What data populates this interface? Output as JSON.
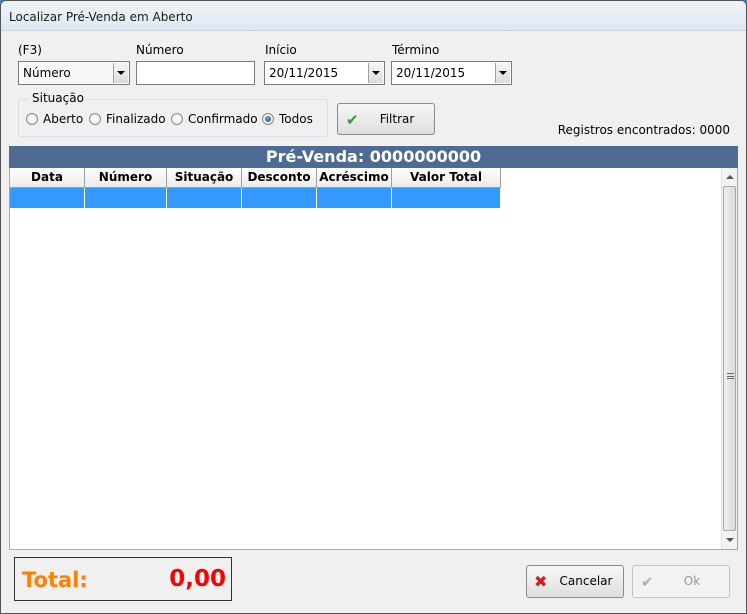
{
  "window": {
    "title": "Localizar Pré-Venda em Aberto"
  },
  "filters": {
    "search_key_label": "(F3)",
    "search_key_value": "Número",
    "numero_label": "Número",
    "numero_value": "",
    "inicio_label": "Início",
    "inicio_value": "20/11/2015",
    "termino_label": "Término",
    "termino_value": "20/11/2015"
  },
  "situacao": {
    "label": "Situação",
    "options": [
      {
        "label": "Aberto",
        "selected": false
      },
      {
        "label": "Finalizado",
        "selected": false
      },
      {
        "label": "Confirmado",
        "selected": false
      },
      {
        "label": "Todos",
        "selected": true
      }
    ]
  },
  "filter_button": {
    "label": "Filtrar",
    "icon": "check-icon"
  },
  "registros_text": "Registros encontrados: 0000",
  "pre_venda_header": "Pré-Venda: 0000000000",
  "grid": {
    "columns": [
      "Data",
      "Número",
      "Situação",
      "Desconto",
      "Acréscimo",
      "Valor Total"
    ]
  },
  "total": {
    "label": "Total:",
    "value": "0,00"
  },
  "buttons": {
    "cancel_label": "Cancelar",
    "ok_label": "Ok"
  },
  "colors": {
    "header_bar": "#4e6b94",
    "selection": "#3399ff",
    "total_label": "#ff8000",
    "total_value": "#ff0000",
    "check_green": "#2e9a2e",
    "cancel_red": "#d21e1e"
  }
}
